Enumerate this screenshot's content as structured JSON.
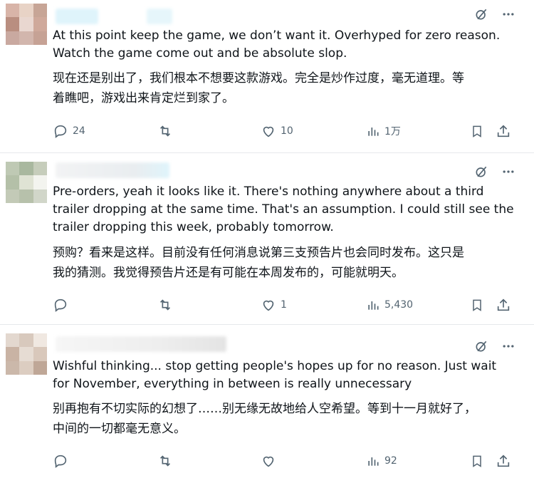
{
  "posts": [
    {
      "text_en": "At this point keep the game, we don’t want it. Overhyped for zero reason.\nWatch the game come out and be absolute slop.",
      "text_cn": "现在还是别出了，我们根本不想要这款游戏。完全是炒作过度，毫无道理。等\n着瞧吧，游戏出来肯定烂到家了。",
      "replies": "24",
      "retweets": "",
      "likes": "10",
      "views": "1万"
    },
    {
      "text_en": "Pre-orders, yeah it looks like it. There's nothing anywhere about a third\ntrailer dropping at the same time. That's an assumption. I could still see the\ntrailer dropping this week, probably tomorrow.",
      "text_cn": "预购？看来是这样。目前没有任何消息说第三支预告片也会同时发布。这只是\n我的猜测。我觉得预告片还是有可能在本周发布的，可能就明天。",
      "replies": "",
      "retweets": "",
      "likes": "1",
      "views": "5,430"
    },
    {
      "text_en": "Wishful thinking... stop getting people's hopes up for no reason. Just wait\nfor November, everything in between is really unnecessary",
      "text_cn": "别再抱有不切实际的幻想了……别无缘无故地给人空希望。等到十一月就好了，\n中间的一切都毫无意义。",
      "replies": "",
      "retweets": "",
      "likes": "",
      "views": "92"
    }
  ],
  "icons": {
    "grok": "grok-icon",
    "more": "more-icon",
    "reply": "reply-icon",
    "retweet": "retweet-icon",
    "like": "like-icon",
    "views": "views-icon",
    "bookmark": "bookmark-icon",
    "share": "share-icon"
  },
  "colors": {
    "text": "#0f1419",
    "muted": "#536471",
    "divider": "#e6e9ec"
  }
}
